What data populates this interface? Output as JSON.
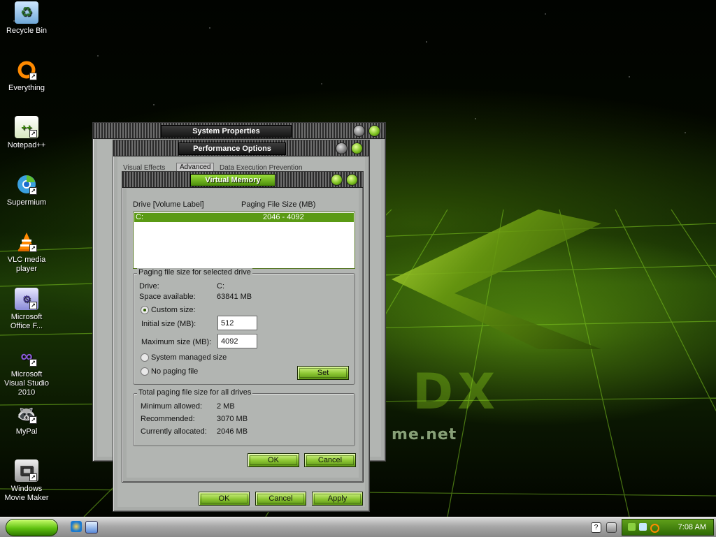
{
  "desktop": {
    "background_text": "me.net",
    "icons": [
      {
        "label": "Recycle Bin",
        "icon": "recycle-bin-icon"
      },
      {
        "label": "Everything",
        "icon": "everything-icon"
      },
      {
        "label": "Notepad++",
        "icon": "notepad-plus-plus-icon"
      },
      {
        "label": "Supermium",
        "icon": "supermium-icon"
      },
      {
        "label": "VLC media player",
        "icon": "vlc-icon"
      },
      {
        "label": "Microsoft Office F...",
        "icon": "office-icon"
      },
      {
        "label": "Microsoft Visual Studio 2010",
        "icon": "visual-studio-icon"
      },
      {
        "label": "MyPal",
        "icon": "mypal-icon"
      },
      {
        "label": "Windows Movie Maker",
        "icon": "movie-maker-icon"
      }
    ]
  },
  "system_properties": {
    "title": "System Properties"
  },
  "performance_options": {
    "title": "Performance Options",
    "tabs": [
      "Visual Effects",
      "Advanced",
      "Data Execution Prevention"
    ],
    "buttons": {
      "ok": "OK",
      "cancel": "Cancel",
      "apply": "Apply"
    }
  },
  "virtual_memory": {
    "title": "Virtual Memory",
    "list_headers": {
      "drive": "Drive  [Volume Label]",
      "paging": "Paging File Size (MB)"
    },
    "list_rows": [
      {
        "drive": "C:",
        "size": "2046 - 4092"
      }
    ],
    "selected_group": {
      "title": "Paging file size for selected drive",
      "drive_label": "Drive:",
      "drive_value": "C:",
      "space_label": "Space available:",
      "space_value": "63841 MB",
      "custom_label": "Custom size:",
      "initial_label": "Initial size (MB):",
      "initial_value": "512",
      "max_label": "Maximum size (MB):",
      "max_value": "4092",
      "system_label": "System managed size",
      "none_label": "No paging file",
      "set_button": "Set"
    },
    "total_group": {
      "title": "Total paging file size for all drives",
      "min_label": "Minimum allowed:",
      "min_value": "2 MB",
      "rec_label": "Recommended:",
      "rec_value": "3070 MB",
      "cur_label": "Currently allocated:",
      "cur_value": "2046 MB"
    },
    "buttons": {
      "ok": "OK",
      "cancel": "Cancel"
    }
  },
  "taskbar": {
    "clock": "7:08 AM"
  },
  "colors": {
    "accent": "#7cc020",
    "accent_dark": "#2f6a05",
    "chrome": "#a9aca9"
  }
}
